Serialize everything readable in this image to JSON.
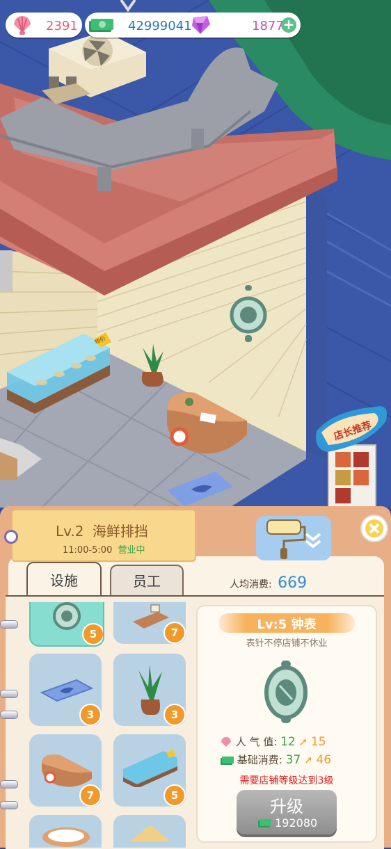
{
  "currency": {
    "shells": "2391",
    "cash": "42999041",
    "gems": "1877"
  },
  "scene": {
    "sign_text": "店长推荐",
    "tank_tag": "特价"
  },
  "shop": {
    "level": "Lv.2",
    "name": "海鲜排挡",
    "hours": "11:00-5:00",
    "status": "营业中"
  },
  "tabs": [
    {
      "label": "设施"
    },
    {
      "label": "员工"
    }
  ],
  "avg_spend": {
    "label": "人均消费:",
    "value": "669"
  },
  "grid": {
    "items": [
      {
        "icon": "clock-icon",
        "level": "5"
      },
      {
        "icon": "display-stand-icon",
        "level": "7"
      },
      {
        "icon": "fish-mat-icon",
        "level": "3"
      },
      {
        "icon": "potted-plant-icon",
        "level": "3"
      },
      {
        "icon": "counter-icon",
        "level": "7"
      },
      {
        "icon": "fish-tank-icon",
        "level": "5"
      },
      {
        "icon": "plate-icon",
        "level": ""
      },
      {
        "icon": "roof-item-icon",
        "level": ""
      }
    ]
  },
  "detail": {
    "title": "Lv:5 钟表",
    "desc": "表针不停店铺不休业",
    "popularity_label": "人 气 值:",
    "popularity_from": "12",
    "popularity_to": "15",
    "spend_label": "基础消费:",
    "spend_from": "37",
    "spend_to": "46",
    "warning": "需要店铺等级达到3级",
    "upgrade_label": "升级",
    "upgrade_cost": "192080"
  },
  "colors": {
    "accent_orange": "#f19a2c",
    "warning_red": "#e02020",
    "level_blue": "#2f8ed8",
    "panel_bg": "#e8ae86"
  }
}
